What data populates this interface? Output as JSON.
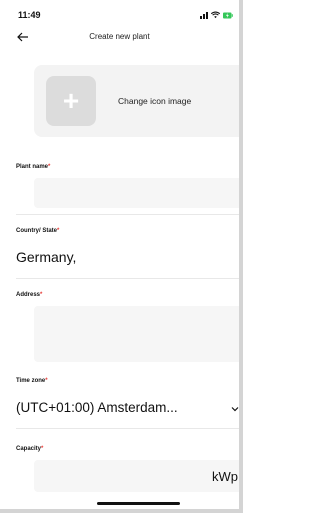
{
  "status_bar": {
    "time": "11:49"
  },
  "header": {
    "title": "Create new plant"
  },
  "icon_card": {
    "change_label": "Change icon image",
    "add_symbol": "+"
  },
  "form": {
    "required_marker": "*",
    "plant_name": {
      "label": "Plant name",
      "value": ""
    },
    "country_state": {
      "label": "Country/ State",
      "value": "Germany,"
    },
    "address": {
      "label": "Address",
      "value": ""
    },
    "time_zone": {
      "label": "Time zone",
      "value": "(UTC+01:00) Amsterdam..."
    },
    "capacity": {
      "label": "Capacity",
      "value": "",
      "unit": "kWp"
    }
  }
}
